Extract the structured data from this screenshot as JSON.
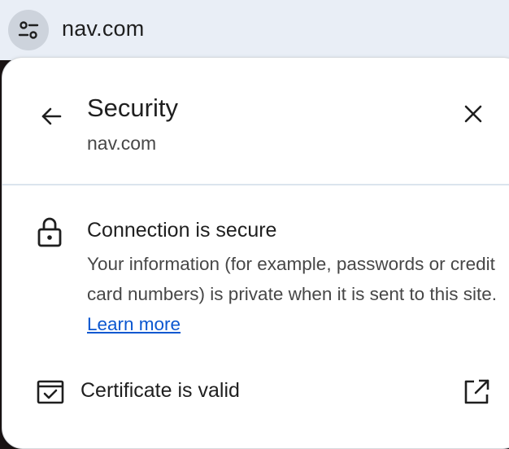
{
  "omnibox": {
    "url": "nav.com",
    "site_info_icon": "tune-icon"
  },
  "security_panel": {
    "title": "Security",
    "subtitle": "nav.com",
    "back_icon": "arrow-left-icon",
    "close_icon": "close-icon",
    "connection": {
      "icon": "lock-icon",
      "title": "Connection is secure",
      "description": "Your information (for example, passwords or credit card numbers) is private when it is sent to this site.",
      "learn_more": "Learn more",
      "link_color": "#0b57d0"
    },
    "certificate": {
      "icon": "certificate-icon",
      "label": "Certificate is valid",
      "action_icon": "open-in-new-icon"
    }
  }
}
